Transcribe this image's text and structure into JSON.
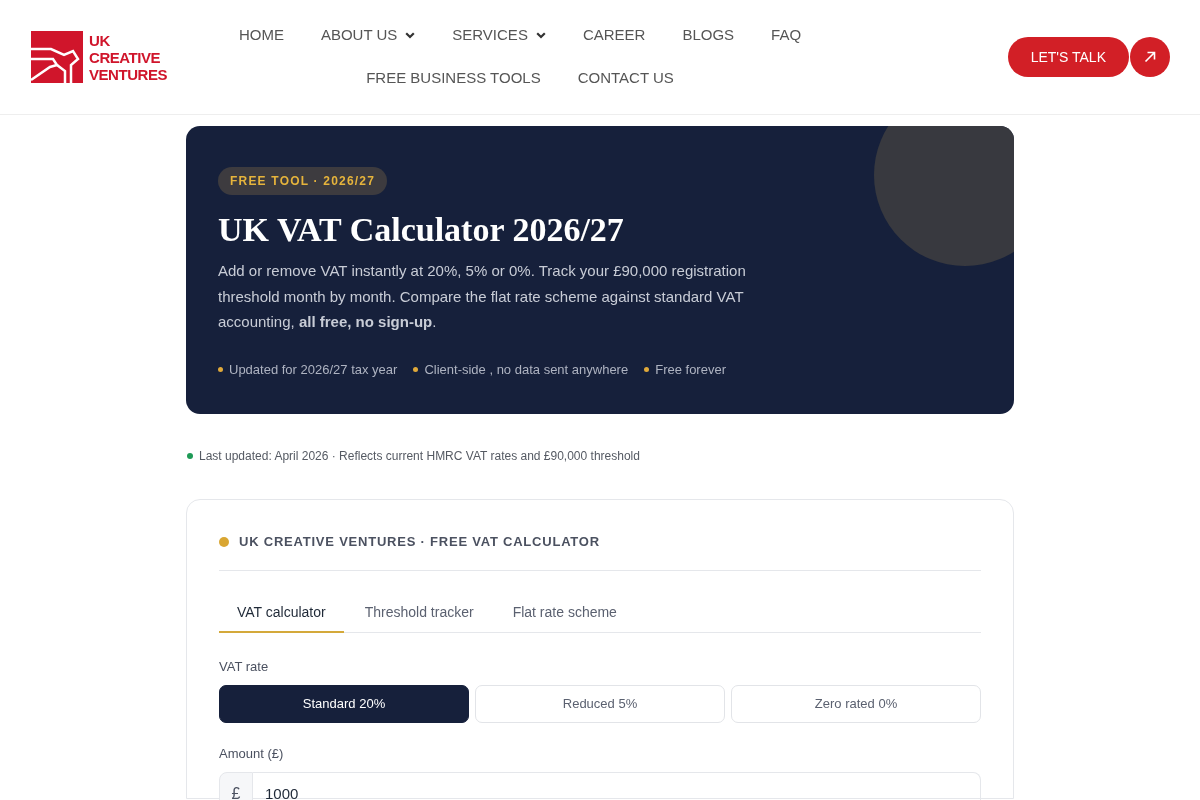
{
  "header": {
    "logo": {
      "lines": [
        "UK",
        "CREATIVE",
        "VENTURES"
      ]
    },
    "nav": [
      {
        "label": "HOME",
        "has_dropdown": false
      },
      {
        "label": "ABOUT US",
        "has_dropdown": true
      },
      {
        "label": "SERVICES",
        "has_dropdown": true
      },
      {
        "label": "CAREER",
        "has_dropdown": false
      },
      {
        "label": "BLOGS",
        "has_dropdown": false
      },
      {
        "label": "FAQ",
        "has_dropdown": false
      },
      {
        "label": "FREE BUSINESS TOOLS",
        "has_dropdown": false
      },
      {
        "label": "CONTACT US",
        "has_dropdown": false
      }
    ],
    "cta": {
      "label": "LET'S TALK"
    }
  },
  "hero": {
    "badge": "FREE TOOL · 2026/27",
    "title": "UK VAT Calculator 2026/27",
    "description": "Add or remove VAT instantly at 20%, 5% or 0%. Track your £90,000 registration threshold month by month. Compare the flat rate scheme against standard VAT accounting, **all free, no sign-up**.",
    "highlights": [
      "Updated for 2026/27 tax year",
      "Client-side , no data sent anywhere",
      "Free forever"
    ]
  },
  "last_updated": "Last updated: April 2026 · Reflects current HMRC VAT rates and £90,000 threshold",
  "calculator": {
    "heading": "UK CREATIVE VENTURES · FREE VAT CALCULATOR",
    "tabs": [
      {
        "label": "VAT calculator",
        "selected": true
      },
      {
        "label": "Threshold tracker",
        "selected": false
      },
      {
        "label": "Flat rate scheme",
        "selected": false
      }
    ],
    "vat_rate": {
      "label": "VAT rate",
      "options": [
        {
          "label": "Standard 20%",
          "selected": true
        },
        {
          "label": "Reduced 5%",
          "selected": false
        },
        {
          "label": "Zero rated 0%",
          "selected": false
        }
      ]
    },
    "amount": {
      "label": "Amount (£)",
      "prefix": "£",
      "value": "1000"
    }
  }
}
